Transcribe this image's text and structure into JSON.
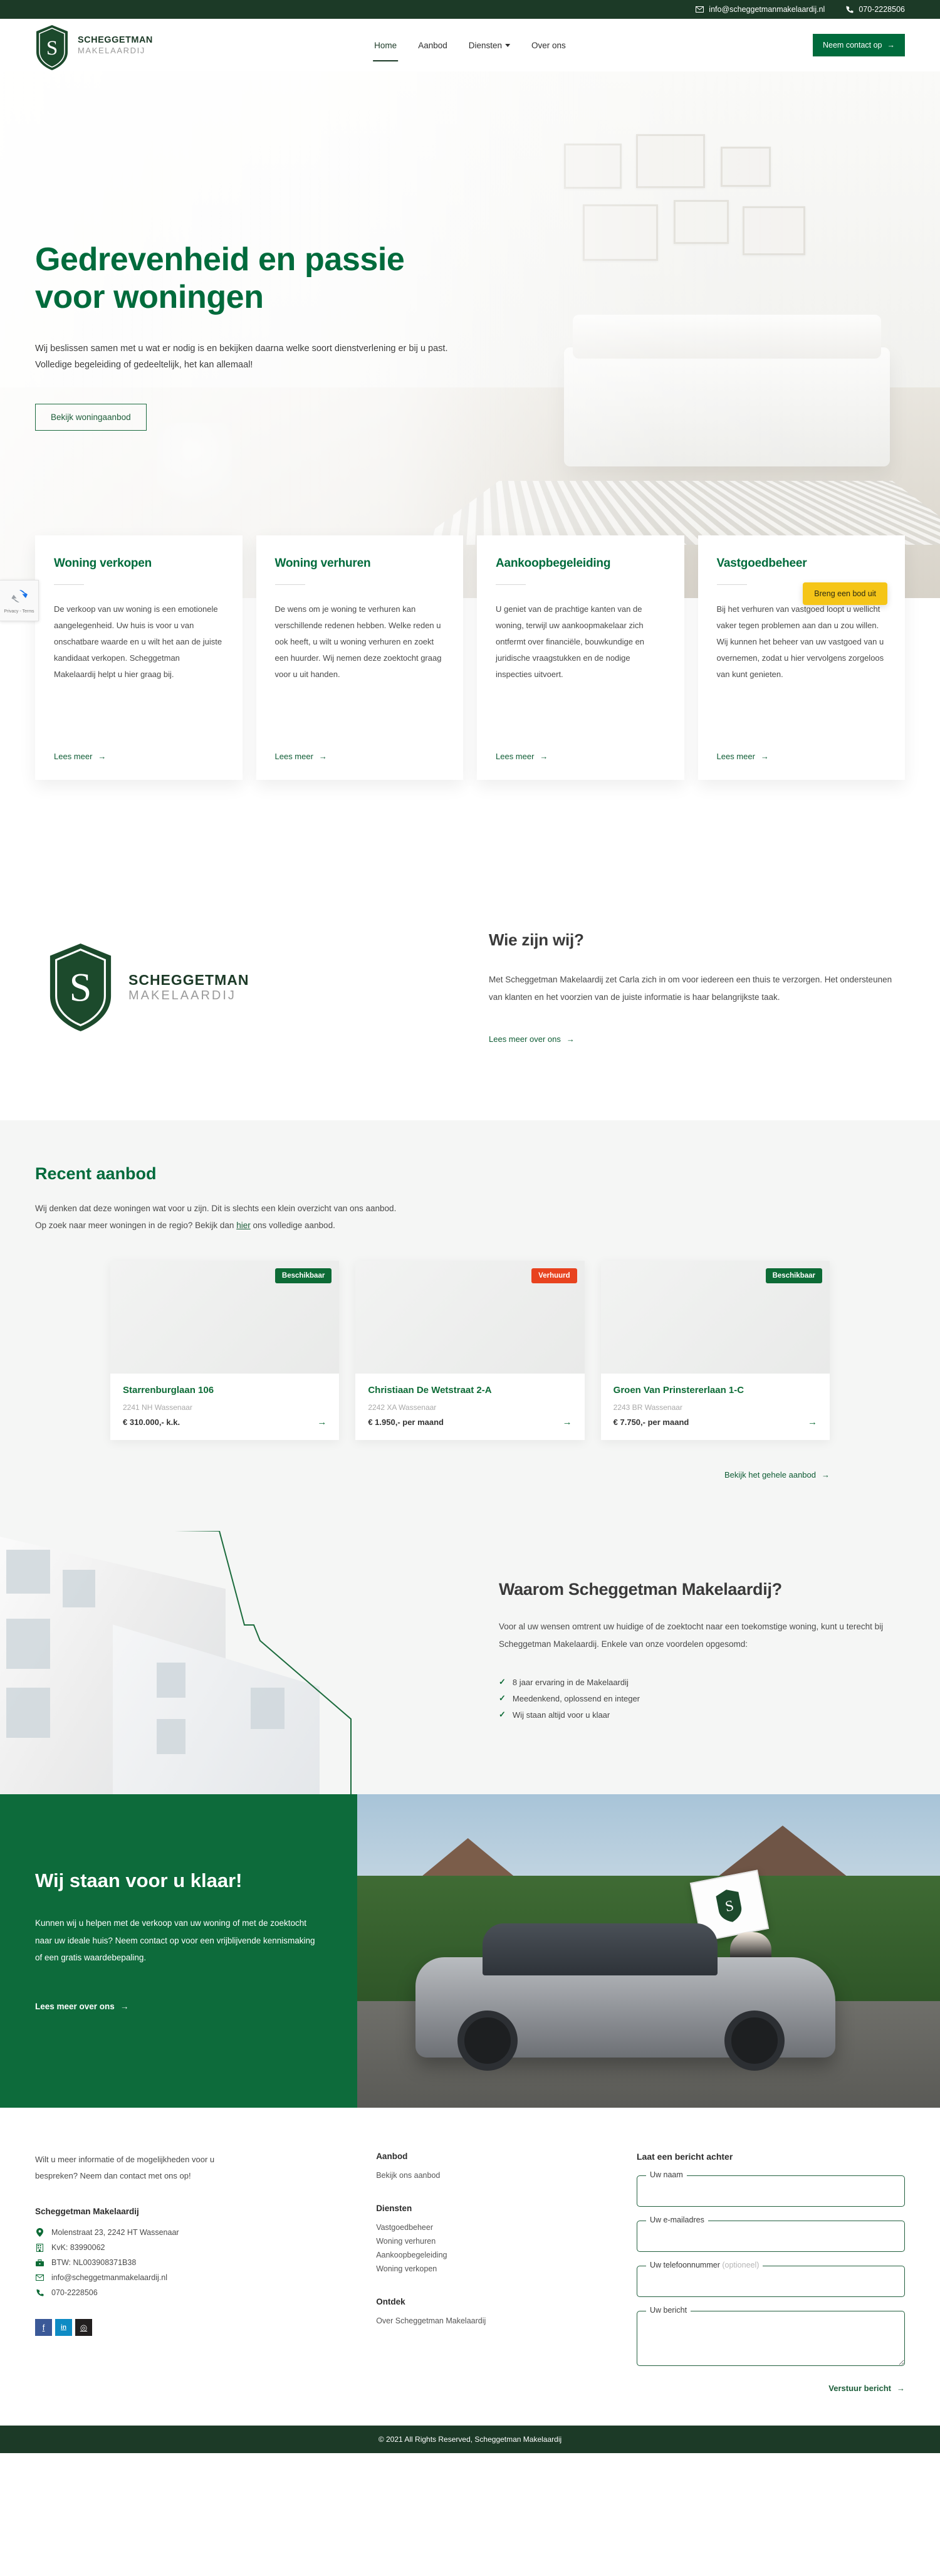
{
  "topbar": {
    "email": "info@scheggetmanmakelaardij.nl",
    "phone": "070-2228506",
    "email_icon": "envelope-icon",
    "phone_icon": "phone-icon"
  },
  "brand": {
    "line1": "SCHEGGETMAN",
    "line2": "MAKELAARDIJ"
  },
  "nav": {
    "items": [
      {
        "label": "Home",
        "active": true
      },
      {
        "label": "Aanbod",
        "active": false
      },
      {
        "label": "Diensten",
        "active": false,
        "has_dropdown": true
      },
      {
        "label": "Over ons",
        "active": false
      }
    ],
    "contact_button": "Neem contact op"
  },
  "hero": {
    "title_line1": "Gedrevenheid en passie",
    "title_line2": "voor woningen",
    "paragraph": "Wij beslissen samen met u wat er nodig is en bekijken daarna welke soort dienstverlening er bij u past. Volledige begeleiding of gedeeltelijk, het kan allemaal!",
    "button": "Bekijk woningaanbod"
  },
  "floating": {
    "bid_button": "Breng een bod uit",
    "recaptcha_privacy": "Privacy",
    "recaptcha_sep": "-",
    "recaptcha_terms": "Terms"
  },
  "services": {
    "read_more": "Lees meer",
    "cards": [
      {
        "title": "Woning verkopen",
        "text": "De verkoop van uw woning is een emotionele aangelegenheid. Uw huis is voor u van onschatbare waarde en u wilt het aan de juiste kandidaat verkopen. Scheggetman Makelaardij helpt u hier graag bij."
      },
      {
        "title": "Woning verhuren",
        "text": "De wens om je woning te verhuren kan verschillende redenen hebben. Welke reden u ook heeft, u wilt u woning verhuren en zoekt een huurder. Wij nemen deze zoektocht graag voor u uit handen."
      },
      {
        "title": "Aankoopbegeleiding",
        "text": "U geniet van de prachtige kanten van de woning, terwijl uw aankoopmakelaar zich ontfermt over financiële, bouwkundige en juridische vraagstukken en de nodige inspecties uitvoert."
      },
      {
        "title": "Vastgoedbeheer",
        "text": "Bij het verhuren van vastgoed loopt u wellicht vaker tegen problemen aan dan u zou willen. Wij kunnen het beheer van uw vastgoed van u overnemen, zodat u hier vervolgens zorgeloos van kunt genieten."
      }
    ]
  },
  "about": {
    "heading": "Wie zijn wij?",
    "paragraph": "Met Scheggetman Makelaardij zet Carla zich in om voor iedereen een thuis te verzorgen. Het ondersteunen van klanten en het voorzien van de juiste informatie is haar belangrijkste taak.",
    "link": "Lees meer over ons"
  },
  "recent": {
    "heading": "Recent aanbod",
    "sub_line1": "Wij denken dat deze woningen wat voor u zijn. Dit is slechts een klein overzicht van ons aanbod.",
    "sub_line2_before": "Op zoek naar meer woningen in de regio? Bekijk dan ",
    "sub_line2_link": "hier",
    "sub_line2_after": " ons volledige aanbod.",
    "cta": "Bekijk het gehele aanbod",
    "properties": [
      {
        "badge": "Beschikbaar",
        "badge_type": "available",
        "title": "Starrenburglaan 106",
        "zip": "2241 NH Wassenaar",
        "price": "€ 310.000,- k.k."
      },
      {
        "badge": "Verhuurd",
        "badge_type": "rented",
        "title": "Christiaan De Wetstraat 2-A",
        "zip": "2242 XA Wassenaar",
        "price": "€ 1.950,- per maand"
      },
      {
        "badge": "Beschikbaar",
        "badge_type": "available",
        "title": "Groen Van Prinstererlaan 1-C",
        "zip": "2243 BR Wassenaar",
        "price": "€ 7.750,- per maand"
      }
    ]
  },
  "why": {
    "heading": "Waarom Scheggetman Makelaardij?",
    "paragraph": "Voor al uw wensen omtrent uw huidige of de zoektocht naar een toekomstige woning, kunt u terecht bij Scheggetman Makelaardij. Enkele van onze voordelen opgesomd:",
    "items": [
      "8 jaar ervaring in de Makelaardij",
      "Meedenkend, oplossend en integer",
      "Wij staan altijd voor u klaar"
    ]
  },
  "cta": {
    "heading": "Wij staan voor u klaar!",
    "paragraph": "Kunnen wij u helpen met de verkoop van uw woning of met de zoektocht naar uw ideale huis? Neem contact op voor een vrijblijvende kennismaking of een gratis waardebepaling.",
    "link": "Lees meer over ons"
  },
  "footer": {
    "intro": "Wilt u meer informatie of de mogelijkheden voor u bespreken? Neem dan contact met ons op!",
    "company": "Scheggetman Makelaardij",
    "details": [
      {
        "icon": "location-pin-icon",
        "text": "Molenstraat 23, 2242 HT Wassenaar"
      },
      {
        "icon": "building-icon",
        "text": "KvK: 83990062"
      },
      {
        "icon": "briefcase-icon",
        "text": "BTW: NL003908371B38"
      },
      {
        "icon": "envelope-icon",
        "text": "info@scheggetmanmakelaardij.nl"
      },
      {
        "icon": "phone-icon",
        "text": "070-2228506"
      }
    ],
    "socials": [
      {
        "name": "facebook-icon",
        "glyph": "f"
      },
      {
        "name": "linkedin-icon",
        "glyph": "in"
      },
      {
        "name": "instagram-icon",
        "glyph": "◎"
      }
    ],
    "columns": [
      {
        "heading": "Aanbod",
        "links": [
          "Bekijk ons aanbod"
        ]
      },
      {
        "heading": "Diensten",
        "links": [
          "Vastgoedbeheer",
          "Woning verhuren",
          "Aankoopbegeleiding",
          "Woning verkopen"
        ]
      },
      {
        "heading": "Ontdek",
        "links": [
          "Over Scheggetman Makelaardij"
        ]
      }
    ],
    "form": {
      "heading": "Laat een bericht achter",
      "name_label": "Uw naam",
      "email_label": "Uw e-mailadres",
      "phone_label": "Uw telefoonnummer",
      "phone_optional": "(optioneel)",
      "message_label": "Uw bericht",
      "submit": "Verstuur bericht"
    },
    "copyright": "© 2021 All Rights Reserved, Scheggetman Makelaardij"
  },
  "colors": {
    "dark_green": "#1c3a27",
    "brand_green": "#006b3c",
    "accent_yellow": "#f5c518",
    "rented_red": "#e8431f",
    "light_gray_bg": "#f5f6f5"
  }
}
